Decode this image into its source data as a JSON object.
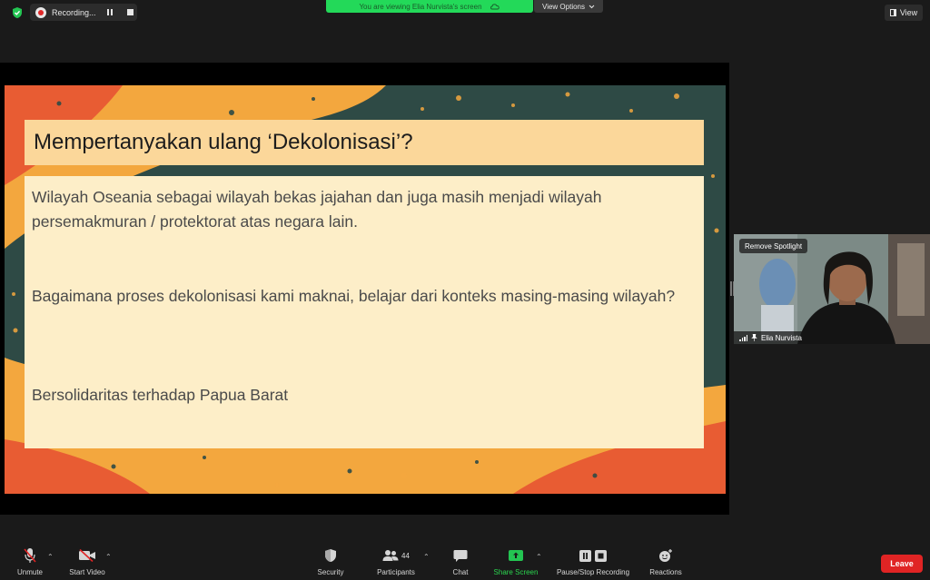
{
  "topbar": {
    "recording_label": "Recording...",
    "viewing_banner": "You are viewing Elia Nurvista's screen",
    "view_options_label": "View Options",
    "view_label": "View"
  },
  "slide": {
    "title": "Mempertanyakan ulang ‘Dekolonisasi’?",
    "paragraphs": [
      "Wilayah Oseania sebagai wilayah bekas jajahan dan juga masih menjadi wilayah persemakmuran / protektorat atas negara lain.",
      "Bagaimana proses dekolonisasi kami maknai, belajar dari konteks masing-masing wilayah?",
      "Bersolidaritas terhadap Papua Barat"
    ],
    "colors": {
      "teal": "#2e4a45",
      "orange": "#f3a73e",
      "red": "#e85c33",
      "title_bg": "#fbd79a",
      "body_bg": "#fdeec8"
    }
  },
  "video": {
    "spotlight_label": "Remove Spotlight",
    "participant_name": "Elia Nurvista"
  },
  "toolbar": {
    "unmute": "Unmute",
    "start_video": "Start Video",
    "security": "Security",
    "participants": "Participants",
    "participants_count": "44",
    "chat": "Chat",
    "share_screen": "Share Screen",
    "pause_stop_recording": "Pause/Stop Recording",
    "reactions": "Reactions",
    "leave": "Leave"
  },
  "icons": [
    "shield-icon",
    "record-icon",
    "pause-icon",
    "stop-icon",
    "cloud-icon",
    "chevron-down-icon",
    "view-icon",
    "microphone-muted-icon",
    "video-off-icon",
    "security-icon",
    "participants-icon",
    "chat-icon",
    "share-screen-icon",
    "pause-recording-icon",
    "reactions-icon",
    "signal-icon",
    "pin-icon"
  ],
  "accent_colors": {
    "green": "#23d959",
    "leave_red": "#e02424"
  }
}
